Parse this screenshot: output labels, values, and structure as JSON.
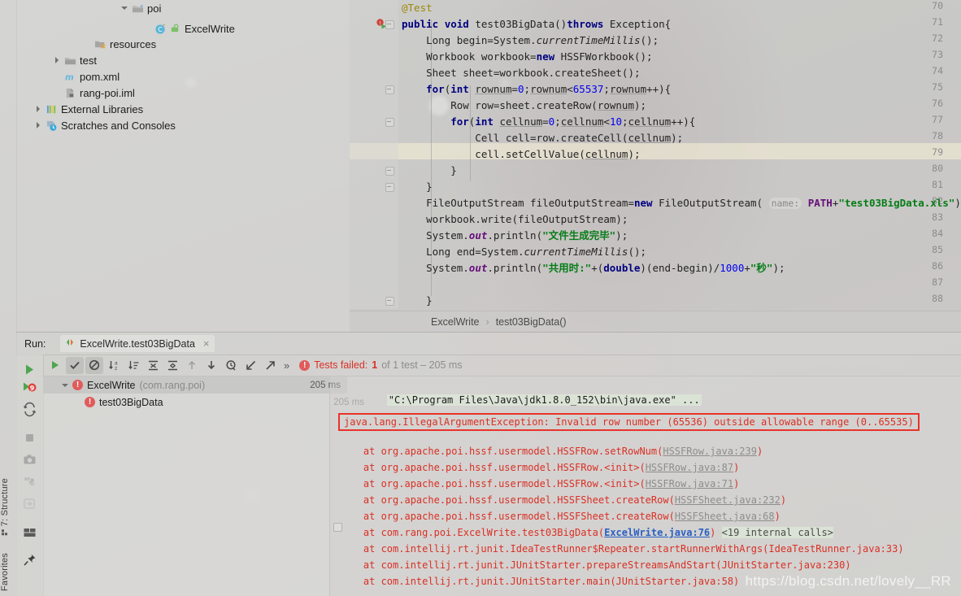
{
  "app": {
    "watermark": "https://blog.csdn.net/lovely__RR"
  },
  "left_strip": {
    "structure_label": "7: Structure",
    "favorites_label": "Favorites"
  },
  "project_tree": {
    "items": [
      {
        "label": "poi",
        "icon": "folder-icon",
        "arrow": "down",
        "indent": 150
      },
      {
        "label": "ExcelWrite",
        "icon": "java-class-icon",
        "arrow": "none",
        "indent": 187
      },
      {
        "label": "resources",
        "icon": "resources-folder-icon",
        "arrow": "none",
        "indent": 100
      },
      {
        "label": "test",
        "icon": "folder-icon",
        "arrow": "right",
        "indent": 63
      },
      {
        "label": "pom.xml",
        "icon": "maven-icon",
        "arrow": "none",
        "indent": 63
      },
      {
        "label": "rang-poi.iml",
        "icon": "iml-file-icon",
        "arrow": "none",
        "indent": 63
      },
      {
        "label": "External Libraries",
        "icon": "libraries-icon",
        "arrow": "right",
        "indent": 25
      },
      {
        "label": "Scratches and Consoles",
        "icon": "scratches-icon",
        "arrow": "right",
        "indent": 25
      }
    ]
  },
  "editor": {
    "first_line_number": 70,
    "highlighted_line": 79,
    "line_numbers": [
      70,
      71,
      72,
      73,
      74,
      75,
      76,
      77,
      78,
      79,
      80,
      81,
      82,
      83,
      84,
      85,
      86,
      87,
      88
    ],
    "lines": [
      "@Test",
      "public void test03BigData()throws Exception{",
      "    Long begin=System.currentTimeMillis();",
      "    Workbook workbook=new HSSFWorkbook();",
      "    Sheet sheet=workbook.createSheet();",
      "    for(int rownum=0;rownum<65537;rownum++){",
      "        Row row=sheet.createRow(rownum);",
      "        for(int cellnum=0;cellnum<10;cellnum++){",
      "            Cell cell=row.createCell(cellnum);",
      "            cell.setCellValue(cellnum);",
      "        }",
      "    }",
      "    FileOutputStream fileOutputStream=new FileOutputStream( name: PATH+\"test03BigData.xls\");",
      "    workbook.write(fileOutputStream);",
      "    System.out.println(\"文件生成完毕\");",
      "    Long end=System.currentTimeMillis();",
      "    System.out.println(\"共用时:\"+(double)(end-begin)/1000+\"秒\");",
      "",
      "}"
    ],
    "param_hint": "name:",
    "breadcrumb": {
      "class": "ExcelWrite",
      "separator": "›",
      "method": "test03BigData()"
    }
  },
  "run_panel": {
    "run_label": "Run:",
    "tab_title": "ExcelWrite.test03BigData",
    "tab_close": "×",
    "toolbar": {
      "rerun": "rerun-icon",
      "show_passed": "show-passed-icon",
      "show_ignored": "show-ignored-icon",
      "sort_alphabetically": "sort-alphabetically-icon",
      "sort_by_duration": "sort-by-duration-icon",
      "expand_all": "expand-all-icon",
      "collapse_all": "collapse-all-icon",
      "prev_failed": "up-arrow-icon",
      "next_failed": "down-arrow-icon",
      "history": "history-icon",
      "import_tests": "import-tests-icon",
      "export_tests": "export-tests-icon",
      "more": "»"
    },
    "side_buttons": [
      "run-icon",
      "rerun-failed-icon",
      "rerun-auto-icon",
      "stop-icon",
      "screenshot-icon",
      "dump-threads-icon",
      "restore-layout-icon",
      "layout-settings-icon",
      "pin-tab-icon"
    ],
    "status": {
      "failed_text": "Tests failed:",
      "failed_count": "1",
      "of_text": "of 1 test – 205 ms"
    },
    "test_tree": [
      {
        "name": "ExcelWrite",
        "package": "(com.rang.poi)",
        "time": "205 ms",
        "level": 0,
        "selected": true,
        "state": "failed"
      },
      {
        "name": "test03BigData",
        "package": "",
        "time": "205 ms",
        "level": 1,
        "selected": false,
        "state": "failed"
      }
    ]
  },
  "console": {
    "command_line": "\"C:\\Program Files\\Java\\jdk1.8.0_152\\bin\\java.exe\" ...",
    "exception": "java.lang.IllegalArgumentException: Invalid row number (65536) outside allowable range (0..65535)",
    "stack_trace": [
      {
        "prefix": "    at org.apache.poi.hssf.usermodel.HSSFRow.setRowNum(",
        "link": "HSSFRow.java:239",
        "suffix": ")",
        "link_style": "gray",
        "extra": ""
      },
      {
        "prefix": "    at org.apache.poi.hssf.usermodel.HSSFRow.<init>(",
        "link": "HSSFRow.java:87",
        "suffix": ")",
        "link_style": "gray",
        "extra": ""
      },
      {
        "prefix": "    at org.apache.poi.hssf.usermodel.HSSFRow.<init>(",
        "link": "HSSFRow.java:71",
        "suffix": ")",
        "link_style": "gray",
        "extra": ""
      },
      {
        "prefix": "    at org.apache.poi.hssf.usermodel.HSSFSheet.createRow(",
        "link": "HSSFSheet.java:232",
        "suffix": ")",
        "link_style": "gray",
        "extra": ""
      },
      {
        "prefix": "    at org.apache.poi.hssf.usermodel.HSSFSheet.createRow(",
        "link": "HSSFSheet.java:68",
        "suffix": ")",
        "link_style": "gray",
        "extra": ""
      },
      {
        "prefix": "    at com.rang.poi.ExcelWrite.test03BigData(",
        "link": "ExcelWrite.java:76",
        "suffix": ")",
        "link_style": "blue",
        "extra": "<19 internal calls>"
      },
      {
        "prefix": "    at com.intellij.rt.junit.IdeaTestRunner$Repeater.startRunnerWithArgs(IdeaTestRunner.java:33)",
        "link": "",
        "suffix": "",
        "link_style": "none",
        "extra": ""
      },
      {
        "prefix": "    at com.intellij.rt.junit.JUnitStarter.prepareStreamsAndStart(JUnitStarter.java:230)",
        "link": "",
        "suffix": "",
        "link_style": "none",
        "extra": ""
      },
      {
        "prefix": "    at com.intellij.rt.junit.JUnitStarter.main(JUnitStarter.java:58)",
        "link": "",
        "suffix": "",
        "link_style": "none",
        "extra": ""
      }
    ]
  },
  "colors": {
    "error_red": "#d93025",
    "keyword_blue": "#000080",
    "string_green": "#067d17",
    "number_blue": "#0000ee",
    "static_purple": "#660e7a",
    "annotation_olive": "#9e880d"
  }
}
